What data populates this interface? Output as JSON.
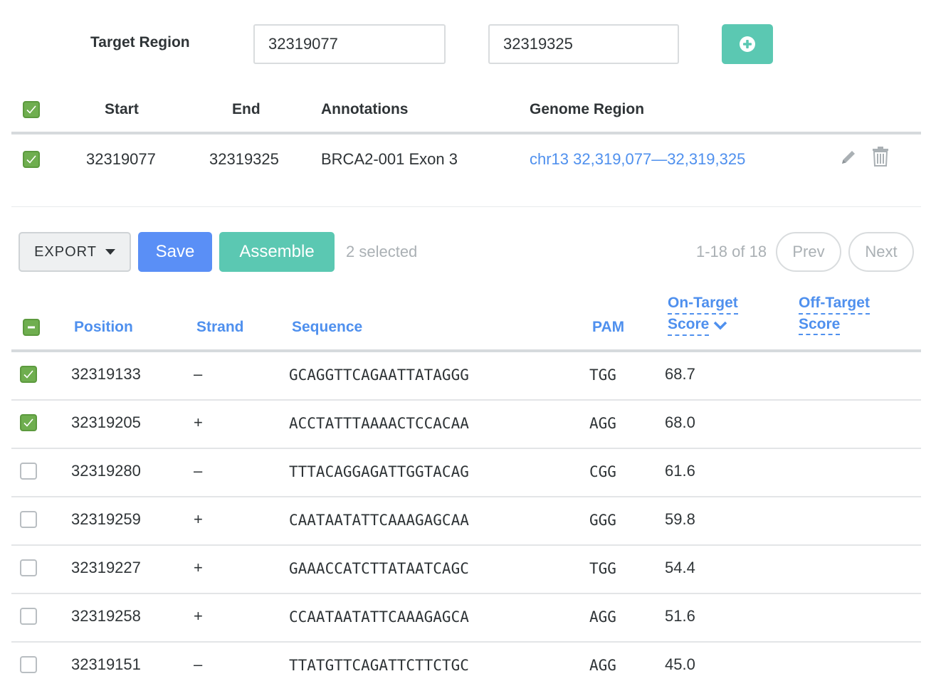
{
  "target_region": {
    "label": "Target Region",
    "start_value": "32319077",
    "end_value": "32319325"
  },
  "regions": {
    "headers": {
      "start": "Start",
      "end": "End",
      "annotations": "Annotations",
      "genome_region": "Genome Region"
    },
    "rows": [
      {
        "start": "32319077",
        "end": "32319325",
        "annotation": "BRCA2-001 Exon 3",
        "genome_region": "chr13 32,319,077—32,319,325",
        "checked": true
      }
    ]
  },
  "toolbar": {
    "export_label": "EXPORT",
    "save_label": "Save",
    "assemble_label": "Assemble",
    "selected_text": "2 selected",
    "count_text": "1-18 of 18",
    "prev_label": "Prev",
    "next_label": "Next"
  },
  "guides": {
    "headers": {
      "position": "Position",
      "strand": "Strand",
      "sequence": "Sequence",
      "pam": "PAM",
      "on_target_line1": "On-Target",
      "on_target_line2": "Score",
      "off_target_line1": "Off-Target",
      "off_target_line2": "Score"
    },
    "rows": [
      {
        "position": "32319133",
        "strand": "–",
        "sequence": "GCAGGTTCAGAATTATAGGG",
        "pam": "TGG",
        "score": "68.7",
        "checked": true
      },
      {
        "position": "32319205",
        "strand": "+",
        "sequence": "ACCTATTTAAAACTCCACAA",
        "pam": "AGG",
        "score": "68.0",
        "checked": true
      },
      {
        "position": "32319280",
        "strand": "–",
        "sequence": "TTTACAGGAGATTGGTACAG",
        "pam": "CGG",
        "score": "61.6",
        "checked": false
      },
      {
        "position": "32319259",
        "strand": "+",
        "sequence": "CAATAATATTCAAAGAGCAA",
        "pam": "GGG",
        "score": "59.8",
        "checked": false
      },
      {
        "position": "32319227",
        "strand": "+",
        "sequence": "GAAACCATCTTATAATCAGC",
        "pam": "TGG",
        "score": "54.4",
        "checked": false
      },
      {
        "position": "32319258",
        "strand": "+",
        "sequence": "CCAATAATATTCAAAGAGCA",
        "pam": "AGG",
        "score": "51.6",
        "checked": false
      },
      {
        "position": "32319151",
        "strand": "–",
        "sequence": "TTATGTTCAGATTCTTCTGC",
        "pam": "AGG",
        "score": "45.0",
        "checked": false
      }
    ]
  },
  "colors": {
    "accent_blue": "#4f90ee",
    "teal": "#5bc8b2",
    "green_check": "#6fae4f",
    "save_blue": "#5a8ff6"
  }
}
